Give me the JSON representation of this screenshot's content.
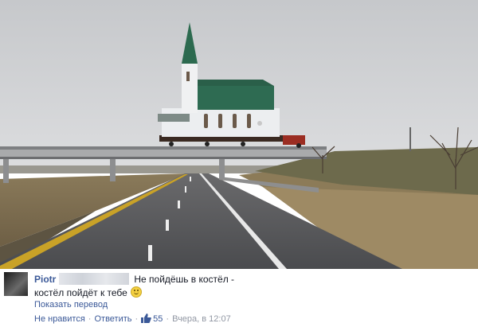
{
  "comment": {
    "author": "Piotr",
    "text_line1": "Не пойдёшь в костёл -",
    "text_line2": "костёл пойдёт к тебе",
    "translate_label": "Показать перевод",
    "unlike_label": "Не нравится",
    "reply_label": "Ответить",
    "like_count": "55",
    "timestamp": "Вчера, в 12:07"
  },
  "icons": [
    "avatar",
    "smiley-icon",
    "thumbs-up-icon"
  ],
  "colors": {
    "link": "#3b5998",
    "text": "#141823",
    "muted": "#9197a3"
  }
}
